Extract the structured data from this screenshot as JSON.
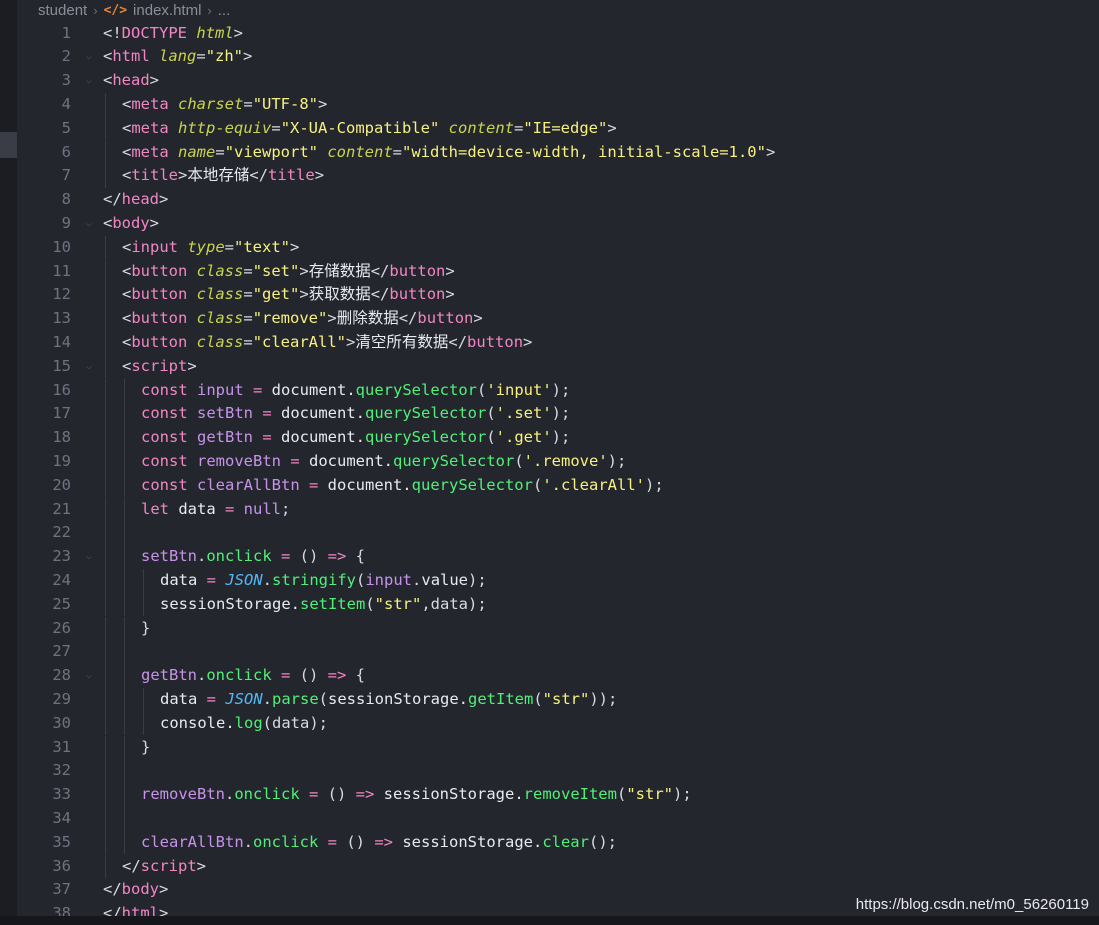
{
  "breadcrumb": {
    "folder": "student",
    "file_icon": "</>",
    "file": "index.html",
    "more": "..."
  },
  "watermark": "https://blog.csdn.net/m0_56260119",
  "colors": {
    "background": "#24262e",
    "line_number": "#6f7380",
    "tag": "#f286c4",
    "attribute": "#c9d44a",
    "string": "#f7f17d",
    "function": "#50f078",
    "variable": "#c792ea",
    "class": "#53b8f6"
  },
  "lines": [
    {
      "n": "1",
      "indent": 0,
      "fold": false,
      "tokens": [
        [
          "punc",
          "<!"
        ],
        [
          "tag",
          "DOCTYPE "
        ],
        [
          "attr",
          "html"
        ],
        [
          "punc",
          ">"
        ]
      ]
    },
    {
      "n": "2",
      "indent": 0,
      "fold": true,
      "tokens": [
        [
          "punc",
          "<"
        ],
        [
          "tag",
          "html "
        ],
        [
          "attr",
          "lang"
        ],
        [
          "punc",
          "="
        ],
        [
          "str",
          "\"zh\""
        ],
        [
          "punc",
          ">"
        ]
      ]
    },
    {
      "n": "3",
      "indent": 0,
      "fold": true,
      "tokens": [
        [
          "punc",
          "<"
        ],
        [
          "tag",
          "head"
        ],
        [
          "punc",
          ">"
        ]
      ]
    },
    {
      "n": "4",
      "indent": 1,
      "fold": false,
      "tokens": [
        [
          "punc",
          "<"
        ],
        [
          "tag",
          "meta "
        ],
        [
          "attr",
          "charset"
        ],
        [
          "punc",
          "="
        ],
        [
          "str",
          "\"UTF-8\""
        ],
        [
          "punc",
          ">"
        ]
      ]
    },
    {
      "n": "5",
      "indent": 1,
      "fold": false,
      "tokens": [
        [
          "punc",
          "<"
        ],
        [
          "tag",
          "meta "
        ],
        [
          "attr",
          "http-equiv"
        ],
        [
          "punc",
          "="
        ],
        [
          "str",
          "\"X-UA-Compatible\" "
        ],
        [
          "attr",
          "content"
        ],
        [
          "punc",
          "="
        ],
        [
          "str",
          "\"IE=edge\""
        ],
        [
          "punc",
          ">"
        ]
      ]
    },
    {
      "n": "6",
      "indent": 1,
      "fold": false,
      "tokens": [
        [
          "punc",
          "<"
        ],
        [
          "tag",
          "meta "
        ],
        [
          "attr",
          "name"
        ],
        [
          "punc",
          "="
        ],
        [
          "str",
          "\"viewport\" "
        ],
        [
          "attr",
          "content"
        ],
        [
          "punc",
          "="
        ],
        [
          "str",
          "\"width=device-width, initial-scale=1.0\""
        ],
        [
          "punc",
          ">"
        ]
      ]
    },
    {
      "n": "7",
      "indent": 1,
      "fold": false,
      "tokens": [
        [
          "punc",
          "<"
        ],
        [
          "tag",
          "title"
        ],
        [
          "punc",
          ">"
        ],
        [
          "txt",
          "本地存储"
        ],
        [
          "punc",
          "</"
        ],
        [
          "tag",
          "title"
        ],
        [
          "punc",
          ">"
        ]
      ]
    },
    {
      "n": "8",
      "indent": 0,
      "fold": false,
      "tokens": [
        [
          "punc",
          "</"
        ],
        [
          "tag",
          "head"
        ],
        [
          "punc",
          ">"
        ]
      ]
    },
    {
      "n": "9",
      "indent": 0,
      "fold": true,
      "tokens": [
        [
          "punc",
          "<"
        ],
        [
          "tag",
          "body"
        ],
        [
          "punc",
          ">"
        ]
      ]
    },
    {
      "n": "10",
      "indent": 1,
      "fold": false,
      "tokens": [
        [
          "punc",
          "<"
        ],
        [
          "tag",
          "input "
        ],
        [
          "attr",
          "type"
        ],
        [
          "punc",
          "="
        ],
        [
          "str",
          "\"text\""
        ],
        [
          "punc",
          ">"
        ]
      ]
    },
    {
      "n": "11",
      "indent": 1,
      "fold": false,
      "tokens": [
        [
          "punc",
          "<"
        ],
        [
          "tag",
          "button "
        ],
        [
          "attr",
          "class"
        ],
        [
          "punc",
          "="
        ],
        [
          "str",
          "\"set\""
        ],
        [
          "punc",
          ">"
        ],
        [
          "txt",
          "存储数据"
        ],
        [
          "punc",
          "</"
        ],
        [
          "tag",
          "button"
        ],
        [
          "punc",
          ">"
        ]
      ]
    },
    {
      "n": "12",
      "indent": 1,
      "fold": false,
      "tokens": [
        [
          "punc",
          "<"
        ],
        [
          "tag",
          "button "
        ],
        [
          "attr",
          "class"
        ],
        [
          "punc",
          "="
        ],
        [
          "str",
          "\"get\""
        ],
        [
          "punc",
          ">"
        ],
        [
          "txt",
          "获取数据"
        ],
        [
          "punc",
          "</"
        ],
        [
          "tag",
          "button"
        ],
        [
          "punc",
          ">"
        ]
      ]
    },
    {
      "n": "13",
      "indent": 1,
      "fold": false,
      "tokens": [
        [
          "punc",
          "<"
        ],
        [
          "tag",
          "button "
        ],
        [
          "attr",
          "class"
        ],
        [
          "punc",
          "="
        ],
        [
          "str",
          "\"remove\""
        ],
        [
          "punc",
          ">"
        ],
        [
          "txt",
          "删除数据"
        ],
        [
          "punc",
          "</"
        ],
        [
          "tag",
          "button"
        ],
        [
          "punc",
          ">"
        ]
      ]
    },
    {
      "n": "14",
      "indent": 1,
      "fold": false,
      "tokens": [
        [
          "punc",
          "<"
        ],
        [
          "tag",
          "button "
        ],
        [
          "attr",
          "class"
        ],
        [
          "punc",
          "="
        ],
        [
          "str",
          "\"clearAll\""
        ],
        [
          "punc",
          ">"
        ],
        [
          "txt",
          "清空所有数据"
        ],
        [
          "punc",
          "</"
        ],
        [
          "tag",
          "button"
        ],
        [
          "punc",
          ">"
        ]
      ]
    },
    {
      "n": "15",
      "indent": 1,
      "fold": true,
      "tokens": [
        [
          "punc",
          "<"
        ],
        [
          "tag",
          "script"
        ],
        [
          "punc",
          ">"
        ]
      ]
    },
    {
      "n": "16",
      "indent": 2,
      "fold": false,
      "tokens": [
        [
          "kw",
          "const "
        ],
        [
          "var",
          "input"
        ],
        [
          "op",
          " = "
        ],
        [
          "txt",
          "document."
        ],
        [
          "fn",
          "querySelector"
        ],
        [
          "punc",
          "("
        ],
        [
          "str",
          "'input'"
        ],
        [
          "punc",
          ");"
        ]
      ]
    },
    {
      "n": "17",
      "indent": 2,
      "fold": false,
      "tokens": [
        [
          "kw",
          "const "
        ],
        [
          "var",
          "setBtn"
        ],
        [
          "op",
          " = "
        ],
        [
          "txt",
          "document."
        ],
        [
          "fn",
          "querySelector"
        ],
        [
          "punc",
          "("
        ],
        [
          "str",
          "'.set'"
        ],
        [
          "punc",
          ");"
        ]
      ]
    },
    {
      "n": "18",
      "indent": 2,
      "fold": false,
      "tokens": [
        [
          "kw",
          "const "
        ],
        [
          "var",
          "getBtn"
        ],
        [
          "op",
          " = "
        ],
        [
          "txt",
          "document."
        ],
        [
          "fn",
          "querySelector"
        ],
        [
          "punc",
          "("
        ],
        [
          "str",
          "'.get'"
        ],
        [
          "punc",
          ");"
        ]
      ]
    },
    {
      "n": "19",
      "indent": 2,
      "fold": false,
      "tokens": [
        [
          "kw",
          "const "
        ],
        [
          "var",
          "removeBtn"
        ],
        [
          "op",
          " = "
        ],
        [
          "txt",
          "document."
        ],
        [
          "fn",
          "querySelector"
        ],
        [
          "punc",
          "("
        ],
        [
          "str",
          "'.remove'"
        ],
        [
          "punc",
          ");"
        ]
      ]
    },
    {
      "n": "20",
      "indent": 2,
      "fold": false,
      "tokens": [
        [
          "kw",
          "const "
        ],
        [
          "var",
          "clearAllBtn"
        ],
        [
          "op",
          " = "
        ],
        [
          "txt",
          "document."
        ],
        [
          "fn",
          "querySelector"
        ],
        [
          "punc",
          "("
        ],
        [
          "str",
          "'.clearAll'"
        ],
        [
          "punc",
          ");"
        ]
      ]
    },
    {
      "n": "21",
      "indent": 2,
      "fold": false,
      "tokens": [
        [
          "kw",
          "let "
        ],
        [
          "txt",
          "data"
        ],
        [
          "op",
          " = "
        ],
        [
          "nul",
          "null"
        ],
        [
          "punc",
          ";"
        ]
      ]
    },
    {
      "n": "22",
      "indent": 2,
      "fold": false,
      "tokens": []
    },
    {
      "n": "23",
      "indent": 2,
      "fold": true,
      "tokens": [
        [
          "var",
          "setBtn"
        ],
        [
          "punc",
          "."
        ],
        [
          "fn",
          "onclick"
        ],
        [
          "op",
          " = "
        ],
        [
          "punc",
          "() "
        ],
        [
          "op",
          "=>"
        ],
        [
          "punc",
          " {"
        ]
      ]
    },
    {
      "n": "24",
      "indent": 3,
      "fold": false,
      "tokens": [
        [
          "txt",
          "data"
        ],
        [
          "op",
          " = "
        ],
        [
          "cls",
          "JSON"
        ],
        [
          "punc",
          "."
        ],
        [
          "fn",
          "stringify"
        ],
        [
          "punc",
          "("
        ],
        [
          "var",
          "input"
        ],
        [
          "punc",
          "."
        ],
        [
          "txt",
          "value"
        ],
        [
          "punc",
          ");"
        ]
      ]
    },
    {
      "n": "25",
      "indent": 3,
      "fold": false,
      "tokens": [
        [
          "txt",
          "sessionStorage."
        ],
        [
          "fn",
          "setItem"
        ],
        [
          "punc",
          "("
        ],
        [
          "str",
          "\"str\""
        ],
        [
          "punc",
          ",data);"
        ]
      ]
    },
    {
      "n": "26",
      "indent": 2,
      "fold": false,
      "tokens": [
        [
          "punc",
          "}"
        ]
      ]
    },
    {
      "n": "27",
      "indent": 2,
      "fold": false,
      "tokens": []
    },
    {
      "n": "28",
      "indent": 2,
      "fold": true,
      "tokens": [
        [
          "var",
          "getBtn"
        ],
        [
          "punc",
          "."
        ],
        [
          "fn",
          "onclick"
        ],
        [
          "op",
          " = "
        ],
        [
          "punc",
          "() "
        ],
        [
          "op",
          "=>"
        ],
        [
          "punc",
          " {"
        ]
      ]
    },
    {
      "n": "29",
      "indent": 3,
      "fold": false,
      "tokens": [
        [
          "txt",
          "data"
        ],
        [
          "op",
          " = "
        ],
        [
          "cls",
          "JSON"
        ],
        [
          "punc",
          "."
        ],
        [
          "fn",
          "parse"
        ],
        [
          "punc",
          "("
        ],
        [
          "txt",
          "sessionStorage."
        ],
        [
          "fn",
          "getItem"
        ],
        [
          "punc",
          "("
        ],
        [
          "str",
          "\"str\""
        ],
        [
          "punc",
          "));"
        ]
      ]
    },
    {
      "n": "30",
      "indent": 3,
      "fold": false,
      "tokens": [
        [
          "txt",
          "console."
        ],
        [
          "fn",
          "log"
        ],
        [
          "punc",
          "(data);"
        ]
      ]
    },
    {
      "n": "31",
      "indent": 2,
      "fold": false,
      "tokens": [
        [
          "punc",
          "}"
        ]
      ]
    },
    {
      "n": "32",
      "indent": 2,
      "fold": false,
      "tokens": []
    },
    {
      "n": "33",
      "indent": 2,
      "fold": false,
      "tokens": [
        [
          "var",
          "removeBtn"
        ],
        [
          "punc",
          "."
        ],
        [
          "fn",
          "onclick"
        ],
        [
          "op",
          " = "
        ],
        [
          "punc",
          "() "
        ],
        [
          "op",
          "=>"
        ],
        [
          "txt",
          " sessionStorage."
        ],
        [
          "fn",
          "removeItem"
        ],
        [
          "punc",
          "("
        ],
        [
          "str",
          "\"str\""
        ],
        [
          "punc",
          ");"
        ]
      ]
    },
    {
      "n": "34",
      "indent": 2,
      "fold": false,
      "tokens": []
    },
    {
      "n": "35",
      "indent": 2,
      "fold": false,
      "tokens": [
        [
          "var",
          "clearAllBtn"
        ],
        [
          "punc",
          "."
        ],
        [
          "fn",
          "onclick"
        ],
        [
          "op",
          " = "
        ],
        [
          "punc",
          "() "
        ],
        [
          "op",
          "=>"
        ],
        [
          "txt",
          " sessionStorage."
        ],
        [
          "fn",
          "clear"
        ],
        [
          "punc",
          "();"
        ]
      ]
    },
    {
      "n": "36",
      "indent": 1,
      "fold": false,
      "tokens": [
        [
          "punc",
          "</"
        ],
        [
          "tag",
          "script"
        ],
        [
          "punc",
          ">"
        ]
      ]
    },
    {
      "n": "37",
      "indent": 0,
      "fold": false,
      "tokens": [
        [
          "punc",
          "</"
        ],
        [
          "tag",
          "body"
        ],
        [
          "punc",
          ">"
        ]
      ]
    },
    {
      "n": "38",
      "indent": 0,
      "fold": false,
      "tokens": [
        [
          "punc",
          "</"
        ],
        [
          "tag",
          "html"
        ],
        [
          "punc",
          ">"
        ]
      ]
    }
  ]
}
